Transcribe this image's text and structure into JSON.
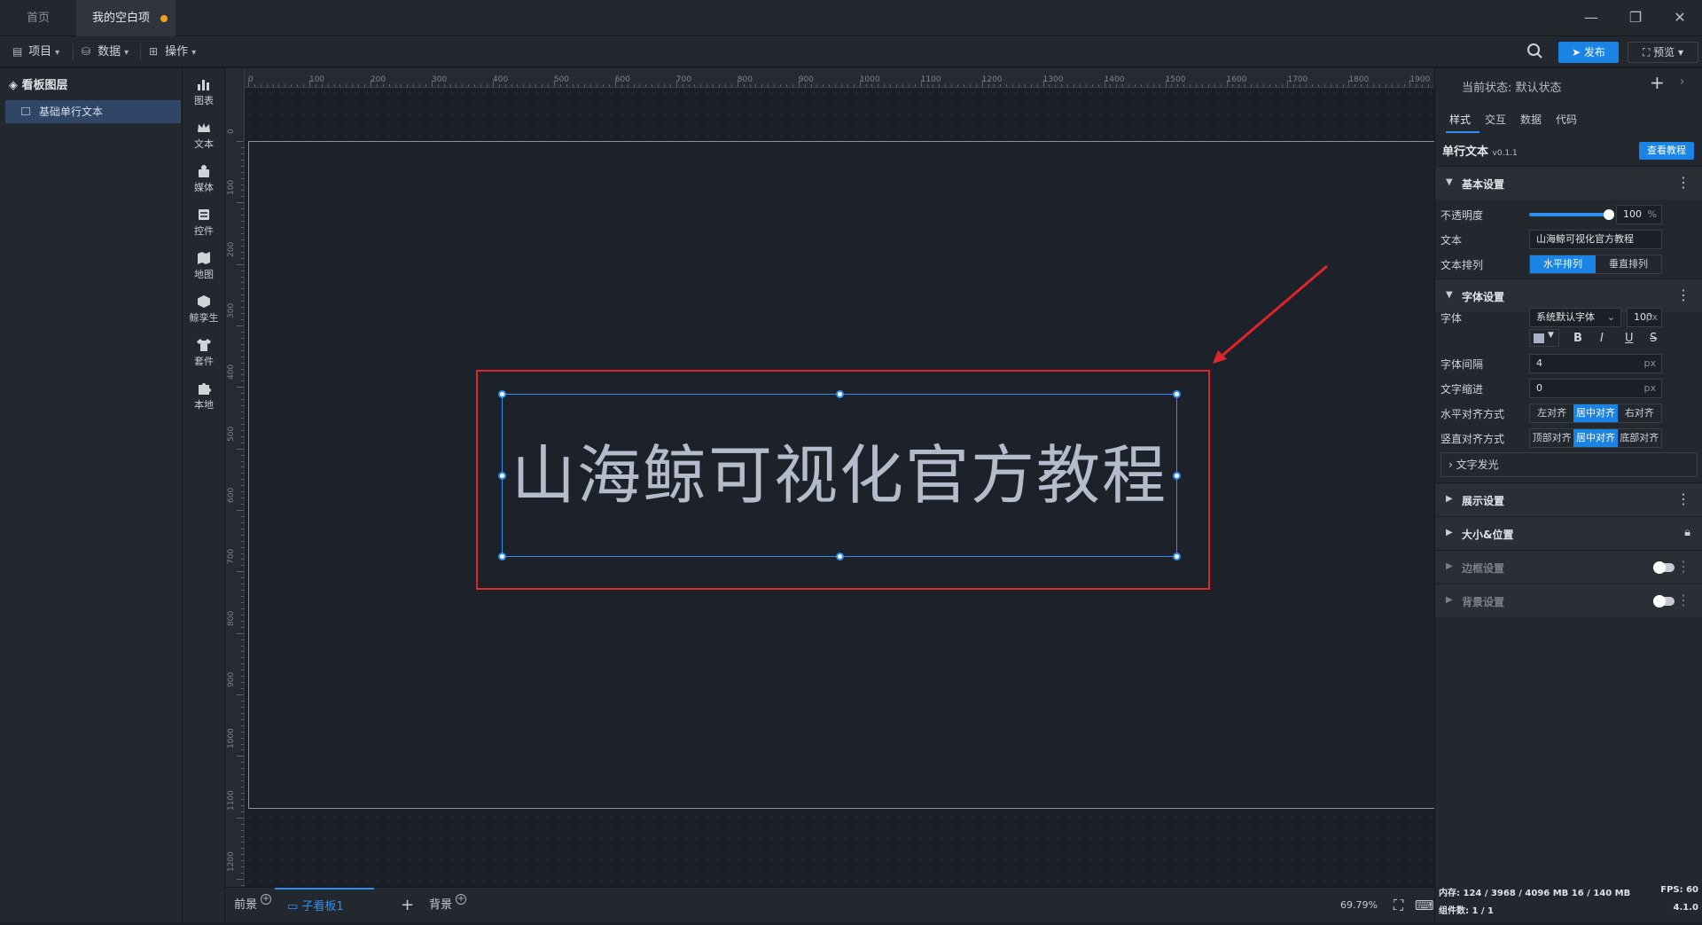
{
  "titlebar": {
    "tab_home": "首页",
    "tab_project": "我的空白项目"
  },
  "toolbar": {
    "project": "项目",
    "data": "数据",
    "operation": "操作",
    "publish": "发布",
    "preview": "预览"
  },
  "layers": {
    "title": "看板图层",
    "items": [
      "基础单行文本"
    ]
  },
  "components": [
    "图表",
    "文本",
    "媒体",
    "控件",
    "地图",
    "鲸孪生",
    "套件",
    "本地"
  ],
  "ruler": {
    "top": [
      "0",
      "100",
      "200",
      "300",
      "400",
      "500",
      "600",
      "700",
      "800",
      "900",
      "1000",
      "1100",
      "1200",
      "1300",
      "1400",
      "1500",
      "1600",
      "1700",
      "1800",
      "1900"
    ],
    "left": [
      "0",
      "100",
      "200",
      "300",
      "400",
      "500",
      "600",
      "700",
      "800",
      "900",
      "1000",
      "1100",
      "1200"
    ]
  },
  "canvas": {
    "text": "山海鲸可视化官方教程"
  },
  "bottombar": {
    "front": "前景",
    "subboard": "子看板1",
    "background": "背景",
    "zoom": "69.79%"
  },
  "rpanel": {
    "state_label": "当前状态:",
    "state_value": "默认状态",
    "tabs": [
      "样式",
      "交互",
      "数据",
      "代码"
    ],
    "component_name": "单行文本",
    "component_version": "v0.1.1",
    "tutorial_button": "查看教程",
    "basic": {
      "title": "基本设置",
      "opacity_label": "不透明度",
      "opacity_value": "100",
      "opacity_unit": "%",
      "opacity_level": 1.0,
      "text_label": "文本",
      "text_value": "山海鲸可视化官方教程",
      "arrange_label": "文本排列",
      "arrange_options": [
        "水平排列",
        "垂直排列"
      ]
    },
    "font": {
      "title": "字体设置",
      "font_label": "字体",
      "font_value": "系统默认字体",
      "size_value": "100",
      "size_unit": "px",
      "color": "#a8b1c9",
      "styles": [
        "B",
        "I",
        "U",
        "S"
      ],
      "spacing_label": "字体间隔",
      "spacing_value": "4",
      "spacing_unit": "px",
      "indent_label": "文字缩进",
      "indent_value": "0",
      "indent_unit": "px",
      "halign_label": "水平对齐方式",
      "halign_options": [
        "左对齐",
        "居中对齐",
        "右对齐"
      ],
      "valign_label": "竖直对齐方式",
      "valign_options": [
        "顶部对齐",
        "居中对齐",
        "底部对齐"
      ],
      "glow": "文字发光"
    },
    "sections": {
      "display": "展示设置",
      "size_pos": "大小&位置",
      "border": "边框设置",
      "bg": "背景设置"
    },
    "footer": {
      "memory": "内存: 124 / 3968 / 4096 MB 16 / 140 MB",
      "fps": "FPS: 60",
      "count": "组件数: 1 / 1",
      "version": "4.1.0"
    }
  },
  "colors": {
    "accent": "#1a84e6",
    "highlight": "#e0242b",
    "selection": "#2f8ff0"
  }
}
